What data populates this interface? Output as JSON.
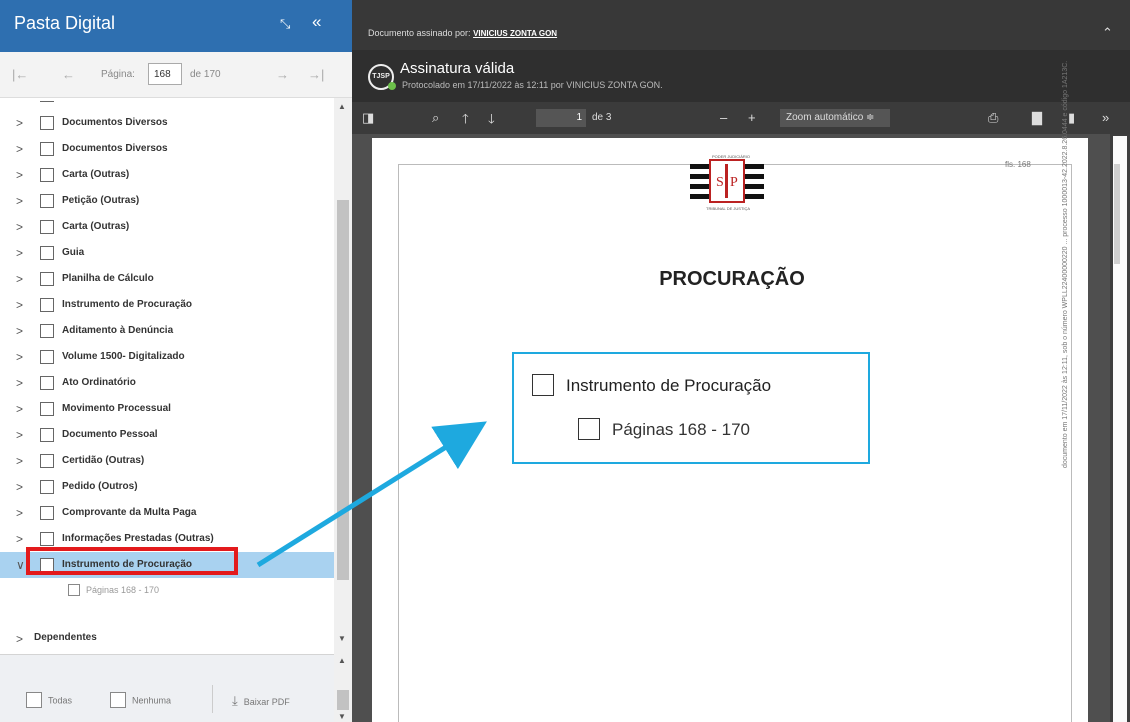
{
  "left_panel": {
    "title": "Pasta Digital",
    "expand_icon": "expand-arrows-icon",
    "collapse_icon": "double-chevron-left-icon",
    "nav": {
      "first": "|←",
      "prev": "←",
      "page_label": "Página:",
      "page_value": "168",
      "of_label": "de 170",
      "next": "→",
      "last": "→|"
    },
    "tree_items": [
      {
        "label": "Documentos Diversos"
      },
      {
        "label": "Documentos Diversos"
      },
      {
        "label": "Carta (Outras)"
      },
      {
        "label": "Petição (Outras)"
      },
      {
        "label": "Carta (Outras)"
      },
      {
        "label": "Guia"
      },
      {
        "label": "Planilha de Cálculo"
      },
      {
        "label": "Instrumento de Procuração"
      },
      {
        "label": "Aditamento à Denúncia"
      },
      {
        "label": "Volume 1500- Digitalizado"
      },
      {
        "label": "Ato Ordinatório"
      },
      {
        "label": "Movimento Processual"
      },
      {
        "label": "Documento Pessoal"
      },
      {
        "label": "Certidão (Outras)"
      },
      {
        "label": "Pedido (Outros)"
      },
      {
        "label": "Comprovante da Multa Paga"
      },
      {
        "label": "Informações Prestadas (Outras)"
      }
    ],
    "selected_item": {
      "label": "Instrumento de Procuração",
      "child": "Páginas 168 - 170"
    },
    "dependents": "Dependentes",
    "footer": {
      "all": "Todas",
      "none": "Nenhuma",
      "download": "Baixar PDF"
    }
  },
  "viewer": {
    "signed_by_label": "Documento assinado por:",
    "signed_by_name": "VINICIUS ZONTA GON",
    "badge": "TJSP",
    "valid_title": "Assinatura válida",
    "protocol": "Protocolado em 17/11/2022 às 12:11 por VINICIUS ZONTA GON.",
    "toolbar": {
      "page_value": "1",
      "of_label": "de 3",
      "minus": "–",
      "plus": "+",
      "zoom": "Zoom automático  ≑",
      "more": "»"
    },
    "document": {
      "fls": "fls. 168",
      "title": "PROCURAÇÃO",
      "side_text": "documento em 17/11/2022 às 12:11, sob o número WPLL22400000220 ... processo 1000013-42.2022.8.26.0444 e código 1A213C."
    },
    "callout": {
      "item": "Instrumento de Procuração",
      "pages": "Páginas 168 - 170"
    }
  },
  "colors": {
    "header_blue": "#2e6fb0",
    "selected_row": "#a9d2f0",
    "highlight_red": "#e31a1c",
    "callout_blue": "#1ea9df"
  }
}
